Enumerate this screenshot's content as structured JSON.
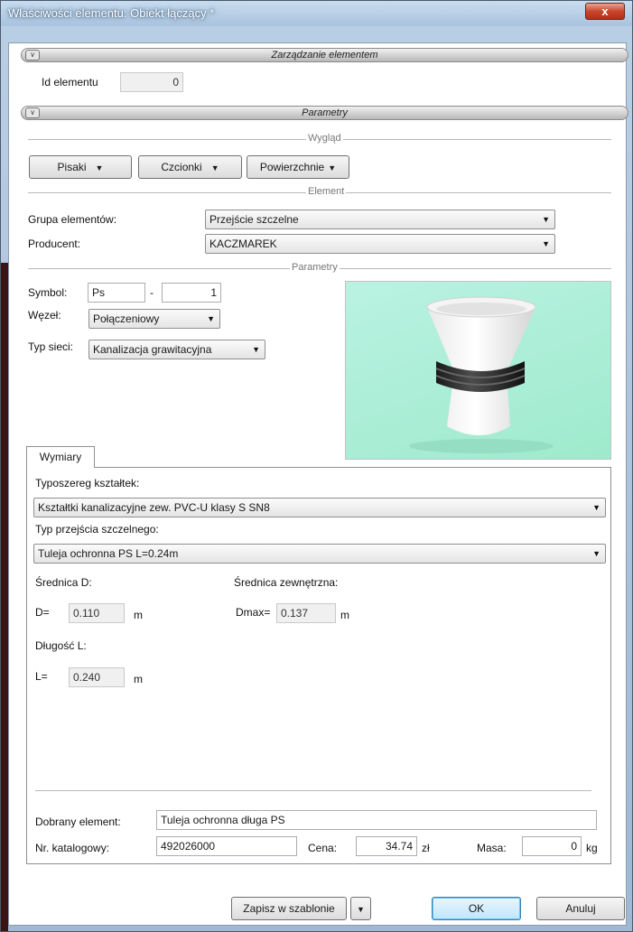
{
  "window": {
    "title": "Właściwości elementu: Obiekt łączący *",
    "close_glyph": "x"
  },
  "section_management": {
    "title": "Zarządzanie elementem",
    "id_label": "Id elementu",
    "id_value": "0"
  },
  "section_params": {
    "title": "Parametry"
  },
  "appearance": {
    "label": "Wygląd",
    "pens": "Pisaki",
    "fonts": "Czcionki",
    "surfaces": "Powierzchnie"
  },
  "element": {
    "label": "Element",
    "group_label": "Grupa elementów:",
    "group_value": "Przejście szczelne",
    "producer_label": "Producent:",
    "producer_value": "KACZMAREK"
  },
  "parameters": {
    "label": "Parametry",
    "symbol_label": "Symbol:",
    "symbol_value": "Ps",
    "symbol_sep": "-",
    "symbol_num": "1",
    "node_label": "Węzeł:",
    "node_value": "Połączeniowy",
    "network_label": "Typ sieci:",
    "network_value": "Kanalizacja grawitacyjna"
  },
  "dimensions": {
    "tab": "Wymiary",
    "series_label": "Typoszereg kształtek:",
    "series_value": "Kształtki kanalizacyjne zew. PVC-U klasy S SN8",
    "seal_label": "Typ przejścia szczelnego:",
    "seal_value": "Tuleja ochronna PS L=0.24m",
    "diameter_label": "Średnica D:",
    "d_prefix": "D=",
    "d_value": "0.110",
    "d_unit": "m",
    "outer_label": "Średnica zewnętrzna:",
    "dmax_prefix": "Dmax=",
    "dmax_value": "0.137",
    "dmax_unit": "m",
    "length_label": "Długość L:",
    "l_prefix": "L=",
    "l_value": "0.240",
    "l_unit": "m"
  },
  "selection": {
    "chosen_label": "Dobrany element:",
    "chosen_value": "Tuleja ochronna długa PS",
    "catalog_label": "Nr. katalogowy:",
    "catalog_value": "492026000",
    "price_label": "Cena:",
    "price_value": "34.74",
    "price_unit": "zł",
    "mass_label": "Masa:",
    "mass_value": "0",
    "mass_unit": "kg"
  },
  "footer": {
    "save_template": "Zapisz w szablonie",
    "ok": "OK",
    "cancel": "Anuluj"
  },
  "colors": {
    "preview_bg": "#a8eed3",
    "title_glow": "#385676",
    "close_red": "#c9462d"
  },
  "icons": {
    "dropdown": "chevron-down-icon",
    "collapse": "collapse-chevron-icon",
    "close": "close-icon"
  }
}
